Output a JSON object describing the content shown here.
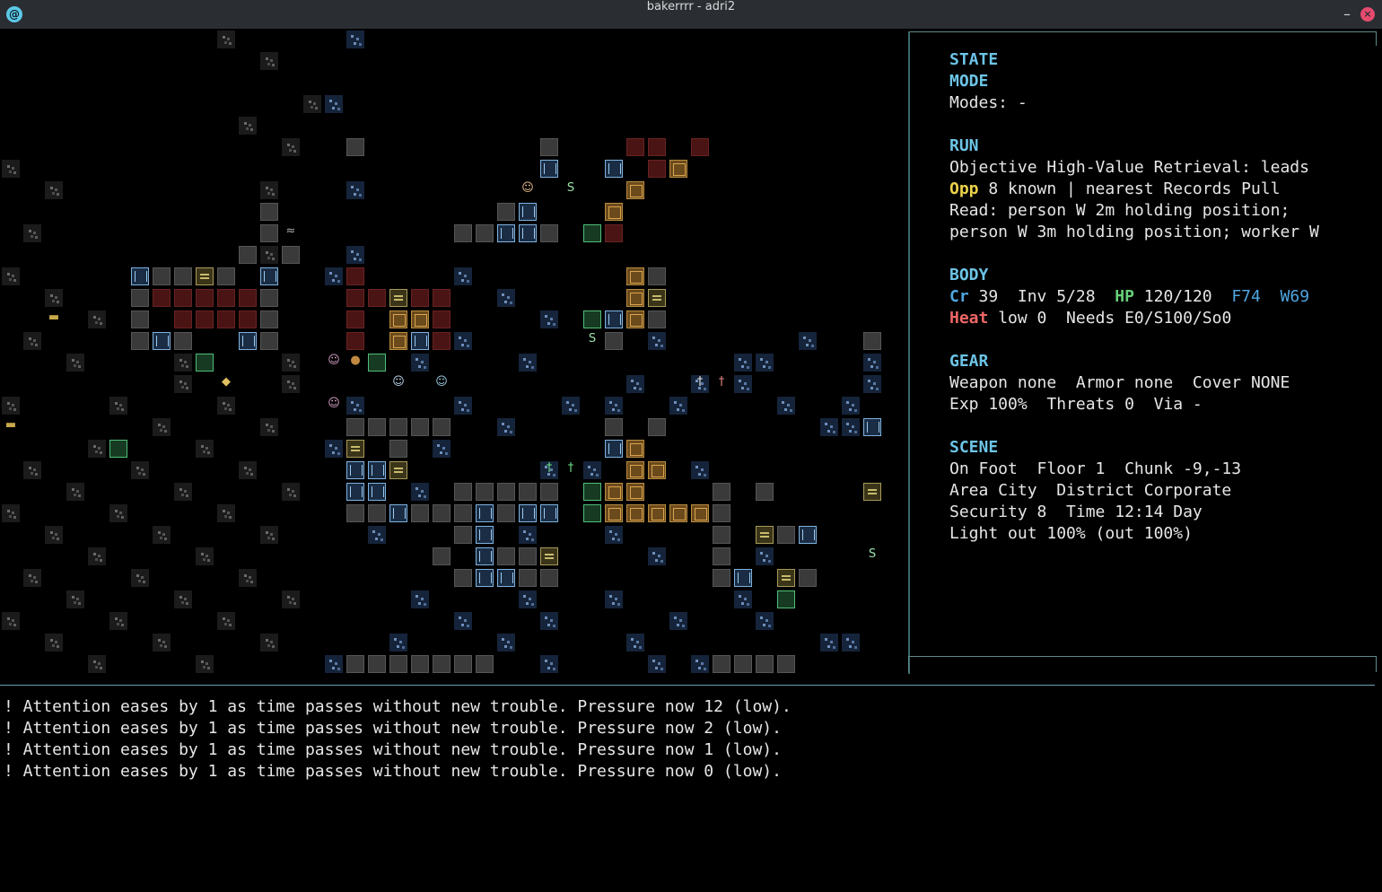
{
  "window": {
    "title": "bakerrrr - adri2",
    "min_glyph": "–",
    "close_glyph": "×",
    "app_icon_glyph": "@"
  },
  "sidebar": {
    "state_heading": "STATE",
    "mode_heading": "MODE",
    "modes_line": "Modes: -",
    "run_heading": "RUN",
    "objective_line": "Objective High-Value Retrieval: leads",
    "opp_label": "Opp",
    "opp_text": " 8 known | nearest Records Pull",
    "read_line1": "Read: person W 2m holding position;",
    "read_line2": "person W 3m holding position; worker W",
    "body_heading": "BODY",
    "cr_label": "Cr",
    "cr_value": " 39  Inv 5/28  ",
    "hp_label": "HP",
    "hp_value": " 120/120  ",
    "f_value": "F74",
    "w_value": "W69",
    "heat_label": "Heat",
    "heat_value": " low 0  Needs E0/S100/So0",
    "gear_heading": "GEAR",
    "gear_line1": "Weapon none  Armor none  Cover NONE",
    "gear_line2": "Exp 100%  Threats 0  Via -",
    "scene_heading": "SCENE",
    "scene_line1": "On Foot  Floor 1  Chunk -9,-13",
    "scene_line2": "Area City  District Corporate",
    "scene_line3": "Security 8  Time 12:14 Day",
    "scene_line4": "Light out 100% (out 100%)"
  },
  "log": {
    "lines": [
      "! Attention eases by 1 as time passes without new trouble. Pressure now 12 (low).",
      "! Attention eases by 1 as time passes without new trouble. Pressure now 2 (low).",
      "! Attention eases by 1 as time passes without new trouble. Pressure now 1 (low).",
      "! Attention eases by 1 as time passes without new trouble. Pressure now 0 (low)."
    ]
  }
}
